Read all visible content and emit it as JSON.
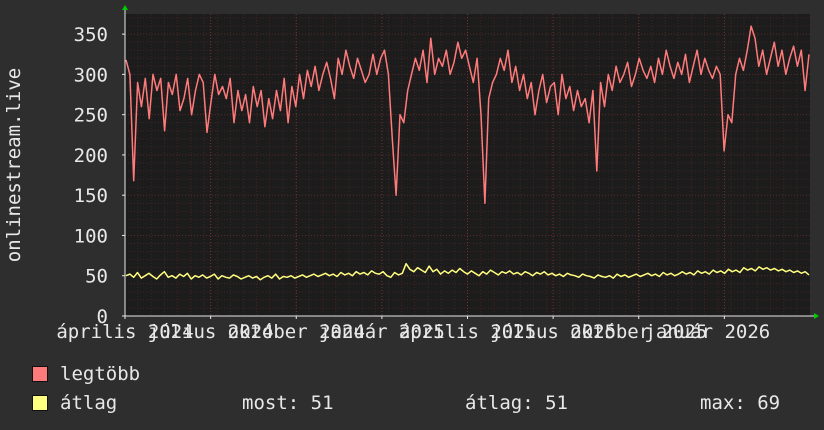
{
  "chart_data": {
    "type": "line",
    "ylabel": "onlinestream.live",
    "ylim": [
      0,
      375
    ],
    "yticks": [
      0,
      50,
      100,
      150,
      200,
      250,
      300,
      350
    ],
    "x_tick_labels": [
      "április 2024",
      "július 2024",
      "október 2024",
      "január 2025",
      "április 2025",
      "július 2025",
      "október 2025",
      "január 2026"
    ],
    "x_tick_positions": [
      0.0,
      0.125,
      0.25,
      0.375,
      0.5,
      0.625,
      0.75,
      0.875
    ],
    "grid": true,
    "background": "#1c1c1c",
    "grid_color": "#5a2a2a",
    "series": [
      {
        "name": "legtöbb",
        "color": "#ff7b7b",
        "values": [
          318,
          300,
          168,
          290,
          260,
          295,
          245,
          300,
          280,
          295,
          230,
          290,
          275,
          300,
          255,
          270,
          295,
          250,
          280,
          300,
          290,
          228,
          265,
          300,
          275,
          285,
          270,
          295,
          240,
          280,
          255,
          275,
          240,
          285,
          260,
          280,
          235,
          270,
          245,
          280,
          255,
          295,
          240,
          285,
          260,
          300,
          270,
          305,
          285,
          310,
          280,
          300,
          315,
          295,
          270,
          320,
          300,
          330,
          310,
          295,
          320,
          305,
          290,
          300,
          325,
          300,
          320,
          330,
          300,
          220,
          150,
          250,
          240,
          280,
          300,
          320,
          305,
          330,
          290,
          345,
          300,
          320,
          310,
          330,
          300,
          315,
          340,
          320,
          330,
          310,
          290,
          320,
          250,
          140,
          270,
          290,
          300,
          320,
          305,
          330,
          290,
          310,
          280,
          300,
          270,
          290,
          250,
          280,
          300,
          265,
          285,
          290,
          250,
          300,
          270,
          285,
          255,
          280,
          260,
          270,
          240,
          280,
          180,
          290,
          260,
          300,
          280,
          310,
          290,
          300,
          315,
          285,
          300,
          320,
          305,
          295,
          310,
          290,
          320,
          300,
          330,
          310,
          295,
          315,
          300,
          325,
          290,
          310,
          330,
          300,
          320,
          305,
          295,
          310,
          300,
          205,
          250,
          240,
          300,
          320,
          305,
          330,
          360,
          345,
          310,
          330,
          300,
          320,
          340,
          310,
          330,
          300,
          320,
          335,
          310,
          330,
          280,
          325
        ],
        "avg": 280
      },
      {
        "name": "átlag",
        "color": "#ffff80",
        "values": [
          50,
          52,
          48,
          54,
          47,
          50,
          53,
          49,
          46,
          51,
          55,
          48,
          50,
          47,
          52,
          49,
          53,
          46,
          50,
          48,
          51,
          47,
          49,
          52,
          46,
          50,
          48,
          47,
          51,
          49,
          46,
          48,
          50,
          47,
          49,
          45,
          48,
          50,
          47,
          52,
          46,
          49,
          48,
          50,
          47,
          49,
          51,
          48,
          50,
          52,
          49,
          51,
          53,
          50,
          52,
          49,
          54,
          51,
          53,
          50,
          55,
          52,
          54,
          51,
          56,
          53,
          52,
          55,
          50,
          48,
          54,
          51,
          53,
          65,
          58,
          55,
          60,
          57,
          54,
          62,
          55,
          58,
          52,
          56,
          53,
          57,
          54,
          59,
          55,
          52,
          56,
          53,
          50,
          55,
          52,
          57,
          54,
          51,
          55,
          53,
          56,
          52,
          54,
          51,
          55,
          53,
          50,
          54,
          52,
          55,
          51,
          53,
          50,
          52,
          49,
          53,
          51,
          50,
          48,
          52,
          50,
          49,
          47,
          51,
          49,
          48,
          50,
          47,
          52,
          49,
          51,
          48,
          50,
          52,
          49,
          51,
          53,
          50,
          52,
          49,
          54,
          51,
          53,
          50,
          52,
          55,
          52,
          54,
          51,
          56,
          53,
          55,
          52,
          57,
          54,
          56,
          53,
          58,
          55,
          57,
          54,
          60,
          57,
          59,
          56,
          61,
          58,
          60,
          57,
          59,
          56,
          58,
          55,
          57,
          54,
          56,
          53,
          55,
          51
        ],
        "avg": 51
      }
    ]
  },
  "legend": [
    {
      "label": "legtöbb",
      "color": "#ff7b7b"
    },
    {
      "label": "átlag",
      "color": "#ffff80",
      "now_label": "most:",
      "now_value": "51",
      "avg_label": "átlag:",
      "avg_value": "51",
      "max_label": "max:",
      "max_value": "69"
    }
  ]
}
